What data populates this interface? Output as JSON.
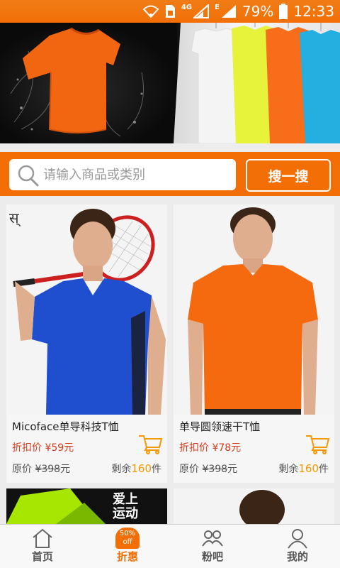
{
  "status_bar": {
    "network_label": "4G",
    "e_label": "E",
    "battery": "79%",
    "time": "12:33"
  },
  "search": {
    "placeholder": "请输入商品或类别",
    "button_label": "搜一搜"
  },
  "products": [
    {
      "name": "Micoface单导科技T恤",
      "discount_label": "折扣价",
      "discount_price": "¥59元",
      "original_label": "原价",
      "original_price": "¥398",
      "original_unit": "元",
      "remain_label": "剩余",
      "remain_count": "160",
      "remain_unit": "件",
      "shirt_color": "#1f4fcf"
    },
    {
      "name": "单导圆领速干T恤",
      "discount_label": "折扣价",
      "discount_price": "¥78元",
      "original_label": "原价",
      "original_price": "¥398",
      "original_unit": "元",
      "remain_label": "剩余",
      "remain_count": "160",
      "remain_unit": "件",
      "shirt_color": "#f56a0f"
    }
  ],
  "partial_banner_text": "爱上运动",
  "tabs": [
    {
      "label": "首页",
      "icon": "home-icon",
      "active": false
    },
    {
      "label": "折惠",
      "icon": "discount-tag-icon",
      "badge_top": "50%",
      "badge_bottom": "off",
      "active": true
    },
    {
      "label": "粉吧",
      "icon": "fans-icon",
      "active": false
    },
    {
      "label": "我的",
      "icon": "user-icon",
      "active": false
    }
  ],
  "colors": {
    "accent": "#f36f06",
    "price_red": "#d63a1b",
    "remain_orange": "#f39800"
  }
}
